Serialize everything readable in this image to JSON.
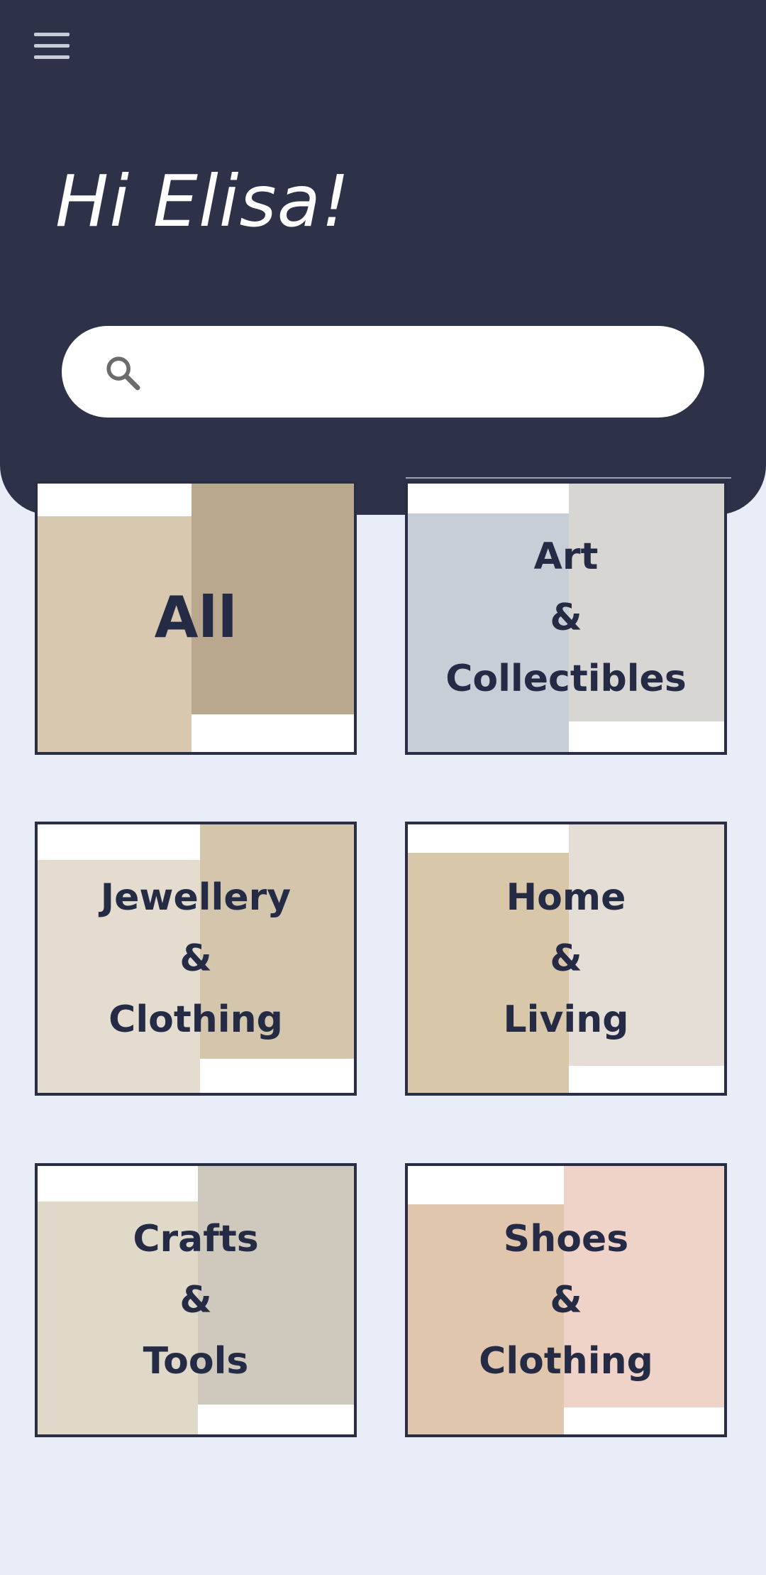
{
  "header": {
    "greeting": "Hi Elisa!",
    "search": {
      "placeholder": "",
      "value": ""
    }
  },
  "categories": [
    {
      "label": "All",
      "photo_left": "#d9c8b0",
      "photo_right": "#b9a88e"
    },
    {
      "label": "Art\n&\nCollectibles",
      "photo_left": "#c7ced6",
      "photo_right": "#d8d6d2"
    },
    {
      "label": "Jewellery\n&\nClothing",
      "photo_left": "#e3dccf",
      "photo_right": "#d4c6ad"
    },
    {
      "label": "Home\n&\nLiving",
      "photo_left": "#d8c7a8",
      "photo_right": "#e4ded6"
    },
    {
      "label": "Crafts\n&\nTools",
      "photo_left": "#e0d8c9",
      "photo_right": "#cfc8bd"
    },
    {
      "label": "Shoes\n&\nClothing",
      "photo_left": "#dfc6ad",
      "photo_right": "#efd3c8"
    }
  ],
  "colors": {
    "header_bg": "#2e3248",
    "page_bg": "#e9edf8",
    "card_border": "#2a2e45",
    "label_text": "#252a45"
  }
}
